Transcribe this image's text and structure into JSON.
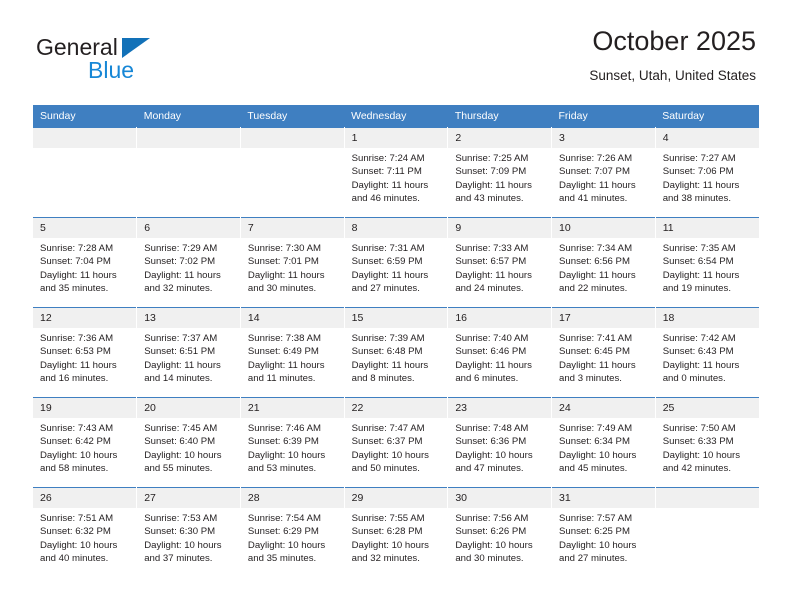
{
  "brand": {
    "name_dark": "General",
    "name_blue": "Blue",
    "triangle_color": "#1271b8",
    "blue_color": "#1787d6"
  },
  "header": {
    "title": "October 2025",
    "subtitle": "Sunset, Utah, United States"
  },
  "theme": {
    "header_bg": "#3f7fc1",
    "daynum_bg": "#f0f0f0",
    "text": "#231f20"
  },
  "weekday_headers": [
    "Sunday",
    "Monday",
    "Tuesday",
    "Wednesday",
    "Thursday",
    "Friday",
    "Saturday"
  ],
  "labels": {
    "sunrise_prefix": "Sunrise:",
    "sunset_prefix": "Sunset:",
    "daylight_prefix": "Daylight:"
  },
  "weeks": [
    [
      {
        "day": "",
        "sunrise": "",
        "sunset": "",
        "daylight": ""
      },
      {
        "day": "",
        "sunrise": "",
        "sunset": "",
        "daylight": ""
      },
      {
        "day": "",
        "sunrise": "",
        "sunset": "",
        "daylight": ""
      },
      {
        "day": "1",
        "sunrise": "Sunrise: 7:24 AM",
        "sunset": "Sunset: 7:11 PM",
        "daylight": "Daylight: 11 hours and 46 minutes."
      },
      {
        "day": "2",
        "sunrise": "Sunrise: 7:25 AM",
        "sunset": "Sunset: 7:09 PM",
        "daylight": "Daylight: 11 hours and 43 minutes."
      },
      {
        "day": "3",
        "sunrise": "Sunrise: 7:26 AM",
        "sunset": "Sunset: 7:07 PM",
        "daylight": "Daylight: 11 hours and 41 minutes."
      },
      {
        "day": "4",
        "sunrise": "Sunrise: 7:27 AM",
        "sunset": "Sunset: 7:06 PM",
        "daylight": "Daylight: 11 hours and 38 minutes."
      }
    ],
    [
      {
        "day": "5",
        "sunrise": "Sunrise: 7:28 AM",
        "sunset": "Sunset: 7:04 PM",
        "daylight": "Daylight: 11 hours and 35 minutes."
      },
      {
        "day": "6",
        "sunrise": "Sunrise: 7:29 AM",
        "sunset": "Sunset: 7:02 PM",
        "daylight": "Daylight: 11 hours and 32 minutes."
      },
      {
        "day": "7",
        "sunrise": "Sunrise: 7:30 AM",
        "sunset": "Sunset: 7:01 PM",
        "daylight": "Daylight: 11 hours and 30 minutes."
      },
      {
        "day": "8",
        "sunrise": "Sunrise: 7:31 AM",
        "sunset": "Sunset: 6:59 PM",
        "daylight": "Daylight: 11 hours and 27 minutes."
      },
      {
        "day": "9",
        "sunrise": "Sunrise: 7:33 AM",
        "sunset": "Sunset: 6:57 PM",
        "daylight": "Daylight: 11 hours and 24 minutes."
      },
      {
        "day": "10",
        "sunrise": "Sunrise: 7:34 AM",
        "sunset": "Sunset: 6:56 PM",
        "daylight": "Daylight: 11 hours and 22 minutes."
      },
      {
        "day": "11",
        "sunrise": "Sunrise: 7:35 AM",
        "sunset": "Sunset: 6:54 PM",
        "daylight": "Daylight: 11 hours and 19 minutes."
      }
    ],
    [
      {
        "day": "12",
        "sunrise": "Sunrise: 7:36 AM",
        "sunset": "Sunset: 6:53 PM",
        "daylight": "Daylight: 11 hours and 16 minutes."
      },
      {
        "day": "13",
        "sunrise": "Sunrise: 7:37 AM",
        "sunset": "Sunset: 6:51 PM",
        "daylight": "Daylight: 11 hours and 14 minutes."
      },
      {
        "day": "14",
        "sunrise": "Sunrise: 7:38 AM",
        "sunset": "Sunset: 6:49 PM",
        "daylight": "Daylight: 11 hours and 11 minutes."
      },
      {
        "day": "15",
        "sunrise": "Sunrise: 7:39 AM",
        "sunset": "Sunset: 6:48 PM",
        "daylight": "Daylight: 11 hours and 8 minutes."
      },
      {
        "day": "16",
        "sunrise": "Sunrise: 7:40 AM",
        "sunset": "Sunset: 6:46 PM",
        "daylight": "Daylight: 11 hours and 6 minutes."
      },
      {
        "day": "17",
        "sunrise": "Sunrise: 7:41 AM",
        "sunset": "Sunset: 6:45 PM",
        "daylight": "Daylight: 11 hours and 3 minutes."
      },
      {
        "day": "18",
        "sunrise": "Sunrise: 7:42 AM",
        "sunset": "Sunset: 6:43 PM",
        "daylight": "Daylight: 11 hours and 0 minutes."
      }
    ],
    [
      {
        "day": "19",
        "sunrise": "Sunrise: 7:43 AM",
        "sunset": "Sunset: 6:42 PM",
        "daylight": "Daylight: 10 hours and 58 minutes."
      },
      {
        "day": "20",
        "sunrise": "Sunrise: 7:45 AM",
        "sunset": "Sunset: 6:40 PM",
        "daylight": "Daylight: 10 hours and 55 minutes."
      },
      {
        "day": "21",
        "sunrise": "Sunrise: 7:46 AM",
        "sunset": "Sunset: 6:39 PM",
        "daylight": "Daylight: 10 hours and 53 minutes."
      },
      {
        "day": "22",
        "sunrise": "Sunrise: 7:47 AM",
        "sunset": "Sunset: 6:37 PM",
        "daylight": "Daylight: 10 hours and 50 minutes."
      },
      {
        "day": "23",
        "sunrise": "Sunrise: 7:48 AM",
        "sunset": "Sunset: 6:36 PM",
        "daylight": "Daylight: 10 hours and 47 minutes."
      },
      {
        "day": "24",
        "sunrise": "Sunrise: 7:49 AM",
        "sunset": "Sunset: 6:34 PM",
        "daylight": "Daylight: 10 hours and 45 minutes."
      },
      {
        "day": "25",
        "sunrise": "Sunrise: 7:50 AM",
        "sunset": "Sunset: 6:33 PM",
        "daylight": "Daylight: 10 hours and 42 minutes."
      }
    ],
    [
      {
        "day": "26",
        "sunrise": "Sunrise: 7:51 AM",
        "sunset": "Sunset: 6:32 PM",
        "daylight": "Daylight: 10 hours and 40 minutes."
      },
      {
        "day": "27",
        "sunrise": "Sunrise: 7:53 AM",
        "sunset": "Sunset: 6:30 PM",
        "daylight": "Daylight: 10 hours and 37 minutes."
      },
      {
        "day": "28",
        "sunrise": "Sunrise: 7:54 AM",
        "sunset": "Sunset: 6:29 PM",
        "daylight": "Daylight: 10 hours and 35 minutes."
      },
      {
        "day": "29",
        "sunrise": "Sunrise: 7:55 AM",
        "sunset": "Sunset: 6:28 PM",
        "daylight": "Daylight: 10 hours and 32 minutes."
      },
      {
        "day": "30",
        "sunrise": "Sunrise: 7:56 AM",
        "sunset": "Sunset: 6:26 PM",
        "daylight": "Daylight: 10 hours and 30 minutes."
      },
      {
        "day": "31",
        "sunrise": "Sunrise: 7:57 AM",
        "sunset": "Sunset: 6:25 PM",
        "daylight": "Daylight: 10 hours and 27 minutes."
      },
      {
        "day": "",
        "sunrise": "",
        "sunset": "",
        "daylight": ""
      }
    ]
  ]
}
